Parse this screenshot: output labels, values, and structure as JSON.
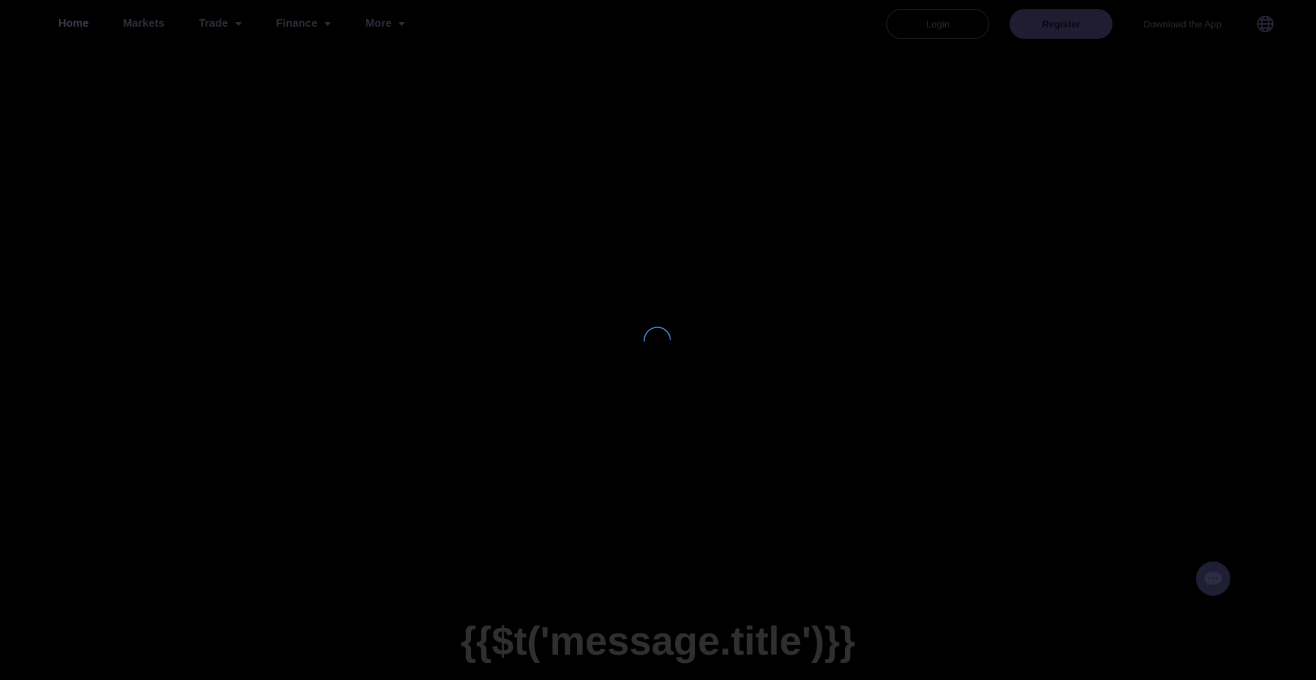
{
  "nav": {
    "home": "Home",
    "markets": "Markets",
    "trade": "Trade",
    "finance": "Finance",
    "more": "More"
  },
  "actions": {
    "login": "Login",
    "register": "Register",
    "download": "Download the App",
    "language_icon": "globe-icon"
  },
  "loading": {
    "icon": "spinner-icon",
    "color": "#4a90e2"
  },
  "chat": {
    "icon": "chat-bubble-icon"
  },
  "message": {
    "title": "{{$t('message.title')}}"
  },
  "colors": {
    "background": "#000000",
    "accent": "#4a90e2",
    "register_bg": "#201d33"
  }
}
